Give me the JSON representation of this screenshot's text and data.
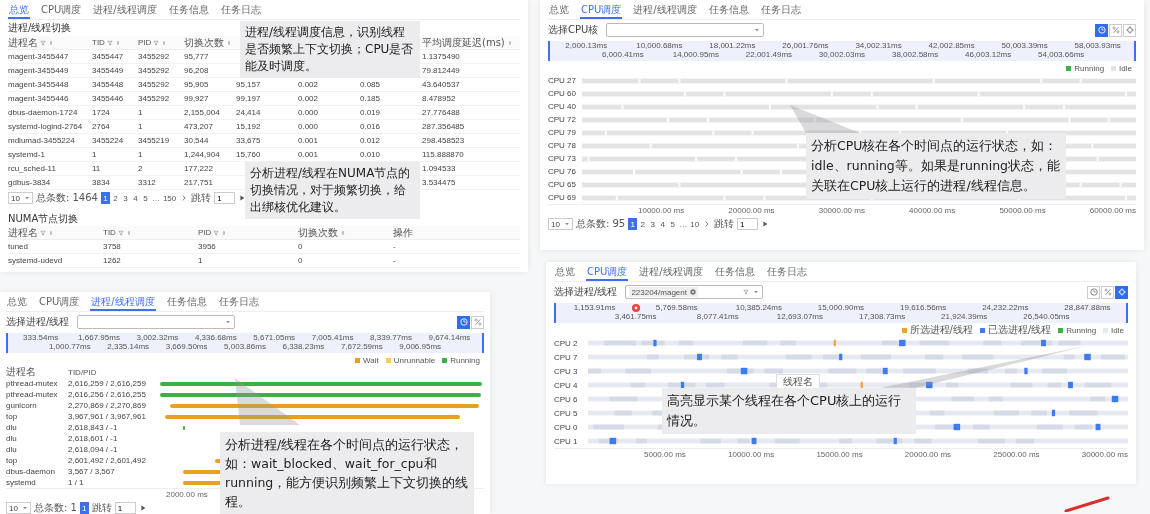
{
  "overview_panel": {
    "tabs": [
      {
        "label": "总览",
        "selected": true
      },
      {
        "label": "CPU调度",
        "selected": false
      },
      {
        "label": "进程/线程调度",
        "selected": false
      },
      {
        "label": "任务信息",
        "selected": false
      },
      {
        "label": "任务日志",
        "selected": false
      }
    ],
    "section_title": "进程/线程切换",
    "table": {
      "columns": [
        "进程名",
        "TID",
        "PID",
        "切换次数",
        null,
        null,
        null,
        "平均调度延迟(ms)"
      ],
      "rows": [
        {
          "cells": [
            "magent-3455447",
            "3455447",
            "3455292",
            "95,777",
            null,
            null,
            null,
            "1.1375490"
          ]
        },
        {
          "cells": [
            "magent-3455449",
            "3455449",
            "3455292",
            "96,208",
            null,
            null,
            null,
            "79.812449"
          ]
        },
        {
          "cells": [
            "magent-3455448",
            "3455448",
            "3455292",
            "95,905",
            "95,157",
            "0.002",
            "0.085",
            "43.640537"
          ]
        },
        {
          "cells": [
            "magent-3455446",
            "3455446",
            "3455292",
            "99,927",
            "99,197",
            "0.002",
            "0.185",
            "8.478952"
          ]
        },
        {
          "cells": [
            "dbus-daemon-1724",
            "1724",
            "1",
            "2,155,004",
            "24,414",
            "0.000",
            "0.019",
            "27.776488"
          ]
        },
        {
          "cells": [
            "systemd-logind-2764",
            "2764",
            "1",
            "473,207",
            "15,192",
            "0.000",
            "0.016",
            "287.356485"
          ]
        },
        {
          "cells": [
            "mdlumad-3455224",
            "3455224",
            "3455219",
            "30,544",
            "33,675",
            "0.001",
            "0.012",
            "298.458523"
          ]
        },
        {
          "cells": [
            "systemd-1",
            "1",
            "1",
            "1,244,904",
            "15,760",
            "0.001",
            "0.010",
            "115.888870"
          ]
        },
        {
          "cells": [
            "rcu_sched-11",
            "11",
            "2",
            "177,222",
            null,
            null,
            null,
            "1.094533"
          ]
        },
        {
          "cells": [
            "gdbus-3834",
            "3834",
            "3312",
            "217,751",
            null,
            null,
            null,
            "3.534475"
          ]
        }
      ]
    },
    "pagination": {
      "page_size": "10",
      "total": "总条数: 1464",
      "pages": [
        {
          "label": "1",
          "selected": true
        },
        {
          "label": "2",
          "selected": false
        },
        {
          "label": "3",
          "selected": false
        },
        {
          "label": "4",
          "selected": false
        },
        {
          "label": "5",
          "selected": false
        },
        {
          "label": "…",
          "selected": false
        },
        {
          "label": "150",
          "selected": false
        }
      ],
      "jump_label": "跳转",
      "jump_value": "1"
    },
    "numa": {
      "title": "NUMA节点切换",
      "columns": [
        "进程名",
        "TID",
        "PID",
        "切换次数",
        "操作"
      ],
      "rows": [
        {
          "cells": [
            "tuned",
            "3758",
            "3956",
            "0",
            "-"
          ]
        },
        {
          "cells": [
            "systemd-udevd",
            "1262",
            "1",
            "0",
            "-"
          ]
        }
      ]
    }
  },
  "thread_panel": {
    "tabs": [
      {
        "label": "总览",
        "selected": false
      },
      {
        "label": "CPU调度",
        "selected": false
      },
      {
        "label": "进程/线程调度",
        "selected": true
      },
      {
        "label": "任务信息",
        "selected": false
      },
      {
        "label": "任务日志",
        "selected": false
      }
    ],
    "select_label": "选择进程/线程",
    "tools": [
      {
        "kind": "clock",
        "selected": true
      },
      {
        "kind": "percent",
        "selected": false
      }
    ],
    "ruler": {
      "level": 1,
      "labels": [
        "333.54ms",
        "1,000.77ms",
        "1,667.95ms",
        "2,335.14ms",
        "3,002.32ms",
        "3,669.50ms",
        "4,336.68ms",
        "5,003.86ms",
        "5,671.05ms",
        "6,338.23ms",
        "7,005.41ms",
        "7,672.59ms",
        "8,339.77ms",
        "9,006.95ms",
        "9,674.14ms"
      ]
    },
    "legend": [
      {
        "kind": "wait",
        "label": "Wait",
        "color": "#e8a020"
      },
      {
        "kind": "unrunnable",
        "label": "Unrunnable",
        "color": "#f2d24b"
      },
      {
        "kind": "running",
        "label": "Running",
        "color": "#3cb043"
      }
    ],
    "columns": [
      "进程名",
      "TID/PID"
    ],
    "rows": [
      {
        "name": "pthread-mutex",
        "ids": "2,616,259 / 2,616,259",
        "kind": "running"
      },
      {
        "name": "pthread-mutex",
        "ids": "2,616,256 / 2,616,255",
        "kind": "running"
      },
      {
        "name": "gunicorn",
        "ids": "2,270,869 / 2,270,869",
        "kind": "wait"
      },
      {
        "name": "top",
        "ids": "3,967,961 / 3,967,961",
        "kind": "wait"
      },
      {
        "name": "dlu",
        "ids": "2,618,843 / -1",
        "kind": "running"
      },
      {
        "name": "dlu",
        "ids": "2,618,601 / -1",
        "kind": "none"
      },
      {
        "name": "dlu",
        "ids": "2,618,094 / -1",
        "kind": "none"
      },
      {
        "name": "top",
        "ids": "2,601,492 / 2,601,492",
        "kind": "wait"
      },
      {
        "name": "dbus-daemon",
        "ids": "3,567 / 3,567",
        "kind": "wait"
      },
      {
        "name": "systemd",
        "ids": "1 / 1",
        "kind": "wait"
      }
    ],
    "axis": [
      "2000.00 ms"
    ],
    "pagination": {
      "page_size": "10",
      "total": "总条数: 1",
      "pages": [
        {
          "label": "1",
          "selected": true
        }
      ],
      "jump_label": "跳转",
      "jump_value": "1"
    }
  },
  "cpu_panel": {
    "tabs": [
      {
        "label": "总览",
        "selected": false
      },
      {
        "label": "CPU调度",
        "selected": true
      },
      {
        "label": "进程/线程调度",
        "selected": false
      },
      {
        "label": "任务信息",
        "selected": false
      },
      {
        "label": "任务日志",
        "selected": false
      }
    ],
    "select_label": "选择CPU核",
    "tools": [
      {
        "kind": "clock",
        "selected": true
      },
      {
        "kind": "percent",
        "selected": false
      },
      {
        "kind": "crosshair",
        "selected": false
      }
    ],
    "ruler": {
      "level": 1,
      "labels": [
        "2,000.13ms",
        "6,000.41ms",
        "10,000.68ms",
        "14,000.95ms",
        "18,001.22ms",
        "22,001.49ms",
        "26,001.76ms",
        "30,002.03ms",
        "34,002.31ms",
        "38,002.58ms",
        "42,002.85ms",
        "46,003.12ms",
        "50,003.39ms",
        "54,003.66ms",
        "58,003.93ms"
      ]
    },
    "legend": [
      {
        "kind": "running",
        "label": "Running",
        "color": "#3cb043"
      },
      {
        "kind": "idle",
        "label": "Idle",
        "color": "#e3e3e3"
      }
    ],
    "cpus": [
      "CPU 27",
      "CPU 60",
      "CPU 40",
      "CPU 72",
      "CPU 79",
      "CPU 78",
      "CPU 73",
      "CPU 76",
      "CPU 65",
      "CPU 69"
    ],
    "axis": [
      "10000.00 ms",
      "20000.00 ms",
      "30000.00 ms",
      "40000.00 ms",
      "50000.00 ms",
      "60000.00 ms"
    ],
    "pagination": {
      "page_size": "10",
      "total": "总条数: 95",
      "pages": [
        {
          "label": "1",
          "selected": true
        },
        {
          "label": "2",
          "selected": false
        },
        {
          "label": "3",
          "selected": false
        },
        {
          "label": "4",
          "selected": false
        },
        {
          "label": "5",
          "selected": false
        },
        {
          "label": "…",
          "selected": false
        },
        {
          "label": "10",
          "selected": false
        }
      ],
      "jump_label": "跳转",
      "jump_value": "1"
    }
  },
  "highlight_panel": {
    "tabs": [
      {
        "label": "总览",
        "selected": false
      },
      {
        "label": "CPU调度",
        "selected": true
      },
      {
        "label": "进程/线程调度",
        "selected": false
      },
      {
        "label": "任务信息",
        "selected": false
      },
      {
        "label": "任务日志",
        "selected": false
      }
    ],
    "select_label": "选择进程/线程",
    "chip": "223204/magent",
    "tools": [
      {
        "kind": "clock",
        "selected": false
      },
      {
        "kind": "percent",
        "selected": false
      },
      {
        "kind": "crosshair",
        "selected": true
      }
    ],
    "ruler": {
      "level": 1,
      "labels": [
        "1,153.91ms",
        "3,461.75ms",
        "5,769.58ms",
        "8,077.41ms",
        "10,385.24ms",
        "12,693.07ms",
        "15,000.90ms",
        "17,308.73ms",
        "19,616.56ms",
        "21,924.39ms",
        "24,232.22ms",
        "26,540.05ms",
        "28,847.88ms"
      ]
    },
    "legend": [
      {
        "kind": "chosen",
        "label": "所选进程/线程",
        "color": "#f0a030"
      },
      {
        "kind": "picked",
        "label": "已选进程/线程",
        "color": "#3d7bf0"
      },
      {
        "kind": "running",
        "label": "Running",
        "color": "#3cb043"
      },
      {
        "kind": "idle",
        "label": "Idle",
        "color": "#e6e9ef"
      }
    ],
    "cpus": [
      "CPU 2",
      "CPU 7",
      "CPU 3",
      "CPU 4",
      "CPU 6",
      "CPU 5",
      "CPU 0",
      "CPU 1"
    ],
    "axis": [
      "5000.00 ms",
      "10000.00 ms",
      "15000.00 ms",
      "20000.00 ms",
      "25000.00 ms",
      "30000.00 ms"
    ],
    "tooltip_label": "线程名"
  },
  "callouts": [
    "进程/线程调度信息，识别线程是否频繁上下文切换；CPU是否能及时调度。",
    "分析进程/线程在NUMA节点的切换情况，对于频繁切换，给出绑核优化建议。",
    "分析进程/线程在各个时间点的运行状态，如：wait_blocked、wait_for_cpu和running，能方便识别频繁上下文切换的线程。",
    "分析CPU核在各个时间点的运行状态，如：idle、running等。如果是running状态，能关联在CPU核上运行的进程/线程信息。",
    "高亮显示某个线程在各个CPU核上的运行情况。"
  ]
}
